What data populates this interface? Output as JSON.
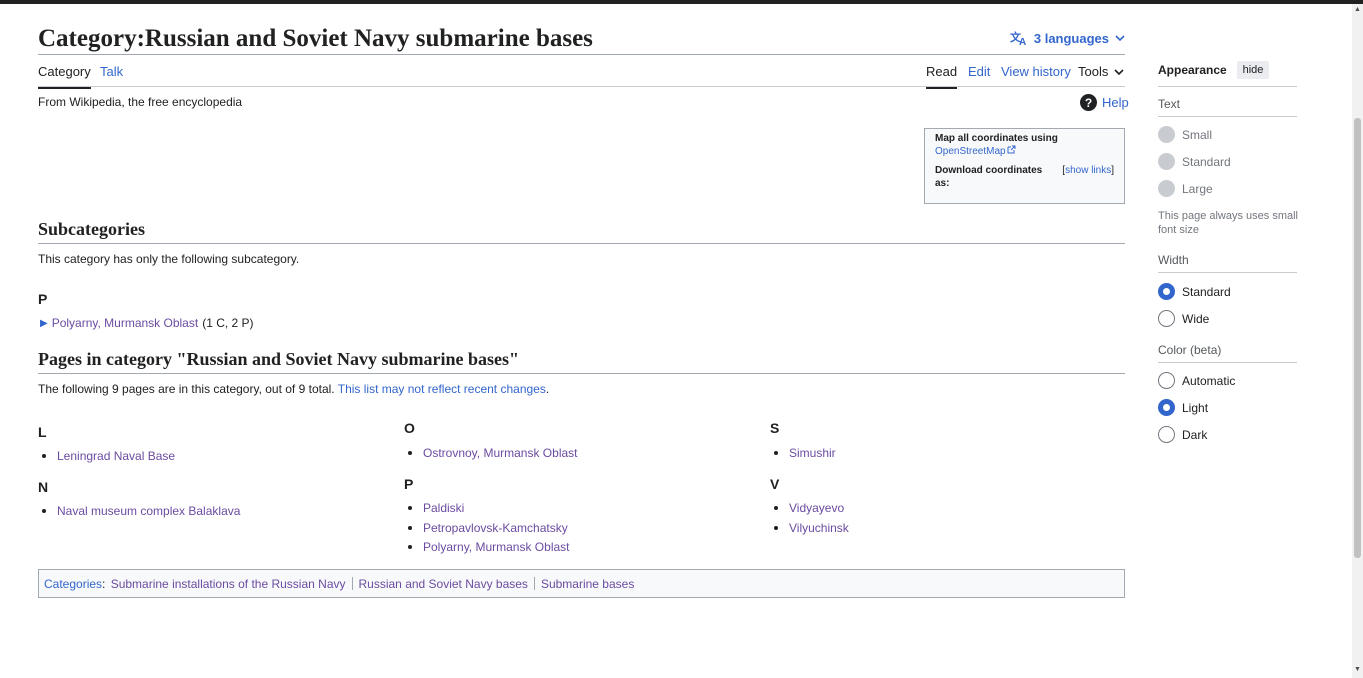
{
  "page": {
    "title": "Category:Russian and Soviet Navy submarine bases",
    "languages_label": "3 languages",
    "tagline": "From Wikipedia, the free encyclopedia",
    "help_label": "Help"
  },
  "tabs": {
    "category": "Category",
    "talk": "Talk",
    "read": "Read",
    "edit": "Edit",
    "view_history": "View history",
    "tools": "Tools"
  },
  "coordinates": {
    "map_label": "Map all coordinates using",
    "map_link": "OpenStreetMap",
    "download_label": "Download coordinates as:",
    "show_links": "show links"
  },
  "subcategories": {
    "heading": "Subcategories",
    "description": "This category has only the following subcategory.",
    "letter": "P",
    "item_label": "Polyarny, Murmansk Oblast",
    "item_count": "(1 C, 2 P)"
  },
  "pages": {
    "heading": "Pages in category \"Russian and Soviet Navy submarine bases\"",
    "description": "The following 9 pages are in this category, out of 9 total.",
    "description_link": "This list may not reflect recent changes",
    "groups": [
      {
        "letter": "L",
        "items": [
          "Leningrad Naval Base"
        ]
      },
      {
        "letter": "N",
        "items": [
          "Naval museum complex Balaklava"
        ]
      },
      {
        "letter": "O",
        "items": [
          "Ostrovnoy, Murmansk Oblast"
        ]
      },
      {
        "letter": "P",
        "items": [
          "Paldiski",
          "Petropavlovsk-Kamchatsky",
          "Polyarny, Murmansk Oblast"
        ]
      },
      {
        "letter": "S",
        "items": [
          "Simushir"
        ]
      },
      {
        "letter": "V",
        "items": [
          "Vidyayevo",
          "Vilyuchinsk"
        ]
      }
    ]
  },
  "categories": {
    "label": "Categories",
    "items": [
      "Submarine installations of the Russian Navy",
      "Russian and Soviet Navy bases",
      "Submarine bases"
    ]
  },
  "appearance": {
    "title": "Appearance",
    "hide_label": "hide",
    "text_label": "Text",
    "text_options": [
      "Small",
      "Standard",
      "Large"
    ],
    "text_note": "This page always uses small font size",
    "width_label": "Width",
    "width_options": [
      "Standard",
      "Wide"
    ],
    "width_selected": "Standard",
    "color_label": "Color (beta)",
    "color_options": [
      "Automatic",
      "Light",
      "Dark"
    ],
    "color_selected": "Light"
  },
  "colors": {
    "link": "#3366cc",
    "visited": "#6b4ba1",
    "text": "#202122",
    "border": "#a2a9b1"
  }
}
